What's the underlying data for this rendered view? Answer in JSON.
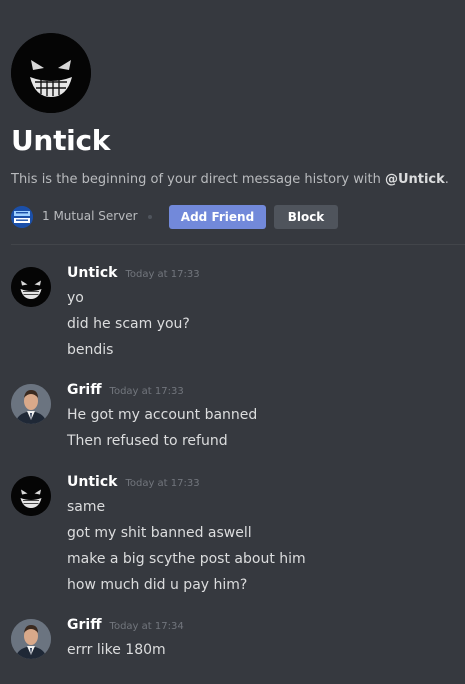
{
  "profile": {
    "name": "Untick",
    "description_prefix": "This is the beginning of your direct message history with ",
    "description_mention": "@Untick",
    "description_suffix": ".",
    "mutual_servers": "1 Mutual Server",
    "add_friend_label": "Add Friend",
    "block_label": "Block"
  },
  "messages": [
    {
      "author": "Untick",
      "timestamp": "Today at 17:33",
      "avatar_icon": "grinning-face-avatar",
      "lines": [
        "yo",
        "did he scam you?",
        "bendis"
      ]
    },
    {
      "author": "Griff",
      "timestamp": "Today at 17:33",
      "avatar_icon": "man-in-suit-avatar",
      "lines": [
        "He got my account banned",
        "Then refused to refund"
      ]
    },
    {
      "author": "Untick",
      "timestamp": "Today at 17:33",
      "avatar_icon": "grinning-face-avatar",
      "lines": [
        "same",
        "got my shit banned aswell",
        "make a big scythe post about him",
        "how much did u pay him?"
      ]
    },
    {
      "author": "Griff",
      "timestamp": "Today at 17:34",
      "avatar_icon": "man-in-suit-avatar",
      "lines": [
        "errr like 180m"
      ]
    }
  ],
  "colors": {
    "background": "#36393f",
    "accent": "#7289da",
    "secondary_button": "#4f545c"
  }
}
